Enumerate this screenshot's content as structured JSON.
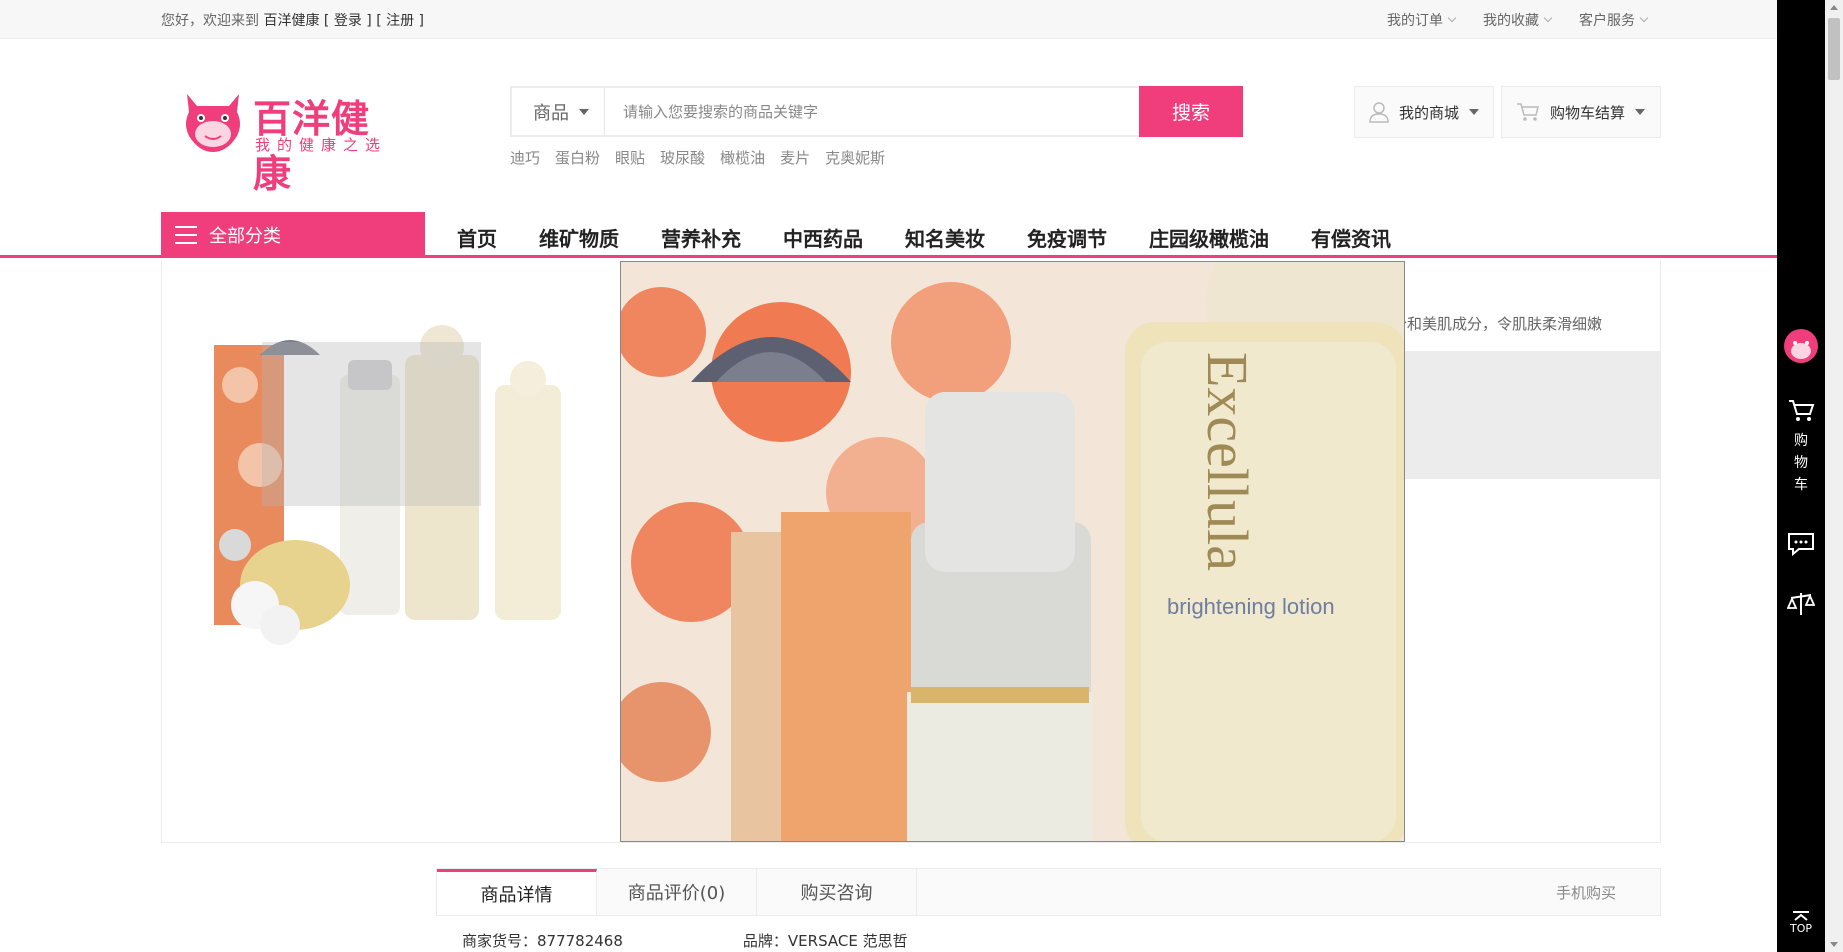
{
  "topbar": {
    "greeting": "您好，欢迎来到",
    "site_name": "百洋健康",
    "login": "[ 登录 ]",
    "register": "[ 注册 ]",
    "links": [
      "我的订单",
      "我的收藏",
      "客户服务"
    ]
  },
  "logo": {
    "brand": "百洋健康",
    "slogan": "我的健康之选"
  },
  "search": {
    "category": "商品",
    "placeholder": "请输入您要搜索的商品关键字",
    "button": "搜索",
    "hot_keywords": [
      "迪巧",
      "蛋白粉",
      "眼贴",
      "玻尿酸",
      "橄榄油",
      "麦片",
      "克奥妮斯"
    ]
  },
  "header_actions": {
    "my_mall": "我的商城",
    "cart": "购物车结算"
  },
  "nav": {
    "all_categories": "全部分类",
    "items": [
      "首页",
      "维矿物质",
      "营养补充",
      "中西药品",
      "知名美妆",
      "免疫调节",
      "庄园级橄榄油",
      "有偿资讯"
    ]
  },
  "product": {
    "description_fragment": "分和美肌成分，令肌肤柔滑细嫩",
    "bottle_text": [
      "Excellula",
      "brightening lotion"
    ]
  },
  "detail_tabs": {
    "tabs": [
      "商品详情",
      "商品评价(0)",
      "购买咨询"
    ],
    "mobile_buy": "手机购买",
    "sku": "商家货号：877782468",
    "brand": "品牌：VERSACE 范思哲"
  },
  "sidebar": {
    "cart_label": [
      "购",
      "物",
      "车"
    ],
    "top": "TOP"
  },
  "colors": {
    "accent": "#ef3e7b",
    "sidebar": "#000000"
  }
}
